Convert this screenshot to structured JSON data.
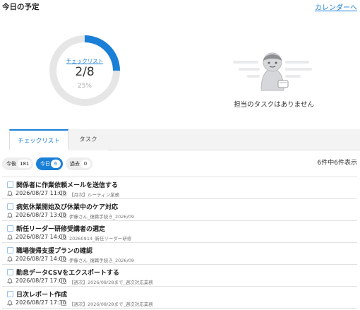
{
  "header": {
    "title": "今日の予定",
    "calendar_link": "カレンダーへ"
  },
  "progress": {
    "link": "チェックリスト",
    "ratio": "2/8",
    "percent": "25%",
    "done": 2,
    "total": 8
  },
  "colors": {
    "accent": "#1a7fd6",
    "track": "#e6e6e6"
  },
  "empty_state": {
    "icon": "person-empty-icon",
    "text": "担当のタスクはありません"
  },
  "tabs": [
    {
      "label": "チェックリスト"
    },
    {
      "label": "タスク"
    }
  ],
  "filters": [
    {
      "label": "今後",
      "count": "181"
    },
    {
      "label": "今日",
      "count": "6"
    },
    {
      "label": "過去",
      "count": "0"
    }
  ],
  "result_count": "6件中6件表示",
  "tasks": [
    {
      "title": "関係者に作業依頼メールを送信する",
      "date": "2026/08/27 11:00",
      "category": "【月次】ルーティン業務"
    },
    {
      "title": "病気休業開始及び休業中のケア対応",
      "date": "2026/08/27 13:00",
      "category": "伊藤さん_復職手続き_2026/09"
    },
    {
      "title": "新任リーダー研修受講者の選定",
      "date": "2026/08/27 14:00",
      "category": "20260914_新任リーダー研修"
    },
    {
      "title": "職場復帰支援プランの確認",
      "date": "2026/08/27 14:00",
      "category": "伊藤さん_復職手続き_2026/09"
    },
    {
      "title": "勤怠データCSVをエクスポートする",
      "date": "2026/08/27 17:00",
      "category": "【週次】2026/08/28まで_週次対応業務"
    },
    {
      "title": "日次レポート作成",
      "date": "2026/08/27 17:30",
      "category": "【週次】2026/08/28まで_週次対応業務"
    }
  ]
}
